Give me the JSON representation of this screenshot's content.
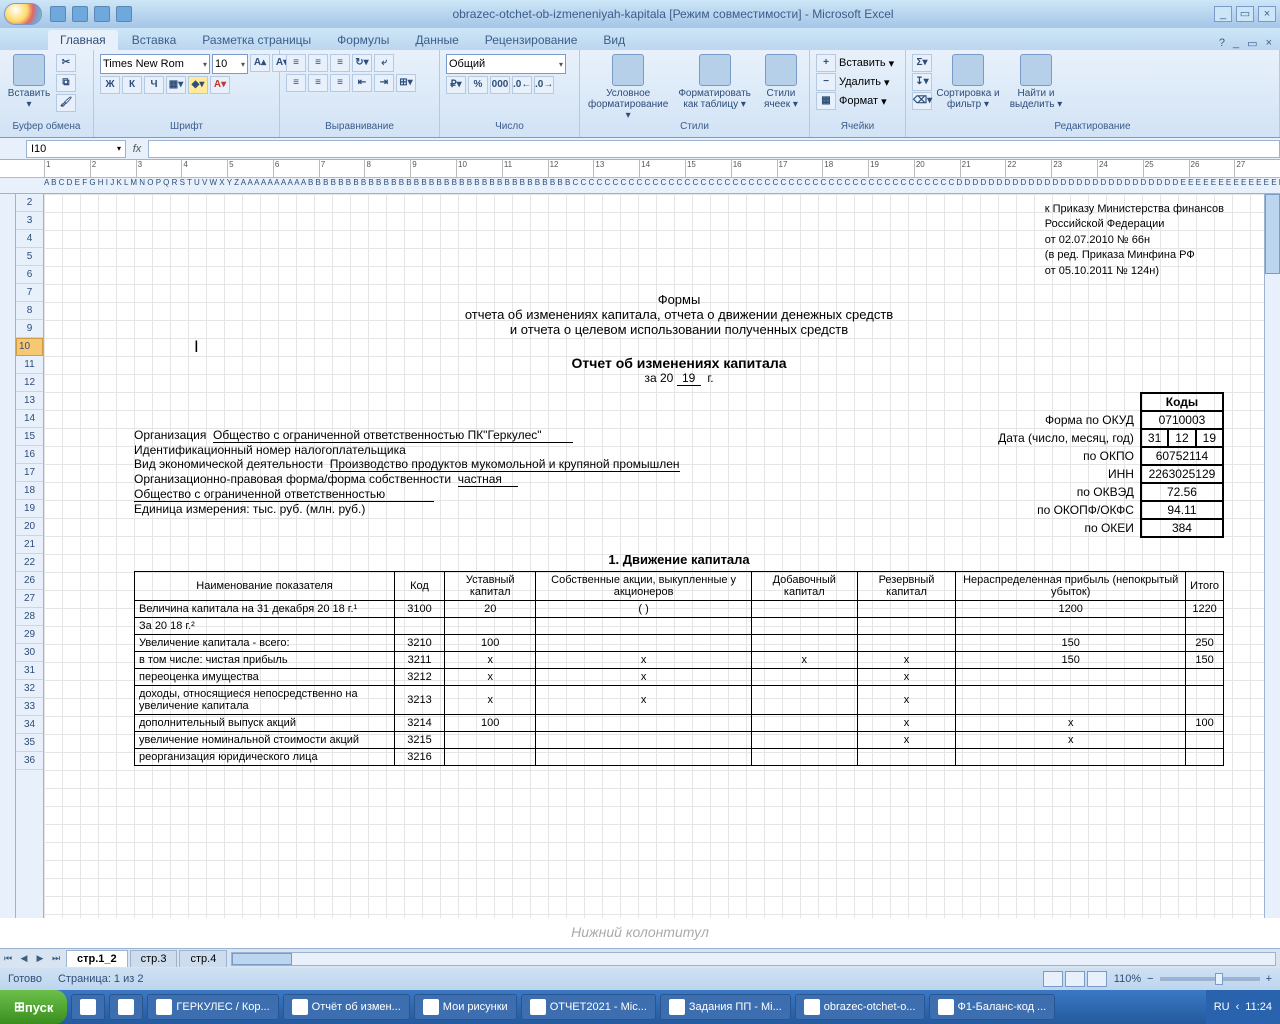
{
  "title": "obrazec-otchet-ob-izmeneniyah-kapitala  [Режим совместимости] - Microsoft Excel",
  "tabs": [
    "Главная",
    "Вставка",
    "Разметка страницы",
    "Формулы",
    "Данные",
    "Рецензирование",
    "Вид"
  ],
  "activeTab": 0,
  "ribbon": {
    "clipboard": {
      "label": "Буфер обмена",
      "paste": "Вставить"
    },
    "font": {
      "label": "Шрифт",
      "name": "Times New Rom",
      "size": "10",
      "bold": "Ж",
      "italic": "К",
      "underline": "Ч"
    },
    "align": {
      "label": "Выравнивание"
    },
    "number": {
      "label": "Число",
      "format": "Общий"
    },
    "styles": {
      "label": "Стили",
      "cond": "Условное форматирование",
      "table": "Форматировать как таблицу",
      "cell": "Стили ячеек"
    },
    "cells": {
      "label": "Ячейки",
      "insert": "Вставить",
      "delete": "Удалить",
      "format": "Формат"
    },
    "edit": {
      "label": "Редактирование",
      "sort": "Сортировка и фильтр",
      "find": "Найти и выделить"
    }
  },
  "nameBox": "I10",
  "colStrip": "A B C D E F G H I J K L M N O P Q R S T U V W X Y Z A A A A A A A A A A B B B B B B B B B B B B B B B B B B B B B B B B B B B B B B B B B B B C C C C C C C C C C C C C C C C C C C C C C C C C C C C C C C C C C C C C C C C C C C C C C C C D D D D D D D D D D D D D D D D D D D D D D D D D D D D E E E E E E E E E E E E E E E E E E E E E E E E E E E E E E",
  "rows": [
    "2",
    "3",
    "4",
    "5",
    "6",
    "7",
    "8",
    "9",
    "10",
    "11",
    "12",
    "13",
    "14",
    "15",
    "16",
    "17",
    "18",
    "19",
    "20",
    "21",
    "22",
    "26",
    "27",
    "28",
    "29",
    "30",
    "31",
    "32",
    "33",
    "34",
    "35",
    "36"
  ],
  "selRow": "10",
  "doc": {
    "hdr": [
      "к Приказу Министерства финансов",
      "Российской Федерации",
      "от 02.07.2010 № 66н",
      "(в ред. Приказа Минфина РФ",
      "от 05.10.2011 № 124н)"
    ],
    "t1": "Формы",
    "t2": "отчета об изменениях капитала, отчета о движении денежных средств",
    "t3": "и отчета о целевом использовании полученных средств",
    "title": "Отчет об изменениях капитала",
    "yearLbl": "за 20",
    "year": "19",
    "yearSuffix": "г.",
    "codesHdr": "Коды",
    "meta": [
      {
        "l": "Форма по ОКУД",
        "v": "0710003"
      },
      {
        "l": "Дата (число, месяц, год)",
        "v": [
          "31",
          "12",
          "19"
        ]
      },
      {
        "l": "по ОКПО",
        "v": "60752114",
        "p": "Организация",
        "pv": "Общество с ограниченной ответственностью ПК\"Геркулес\""
      },
      {
        "l": "ИНН",
        "v": "2263025129",
        "p": "Идентификационный номер налогоплательщика"
      },
      {
        "l": "по ОКВЭД",
        "v": "72.56",
        "p": "Вид экономической деятельности",
        "pv": "Производство продуктов мукомольной и крупяной промышлен"
      },
      {
        "l": "по ОКОПФ/ОКФС",
        "v": "94.11",
        "p": "Организационно-правовая форма/форма собственности",
        "pv": "частная",
        "p2": "Общество с ограниченной ответственностью"
      },
      {
        "l": "по ОКЕИ",
        "v": "384",
        "p": "Единица измерения: тыс. руб. (млн. руб.)"
      }
    ],
    "sec": "1. Движение капитала",
    "th": [
      "Наименование показателя",
      "Код",
      "Уставный капитал",
      "Собственные акции, выкупленные у акционеров",
      "Добавочный капитал",
      "Резервный капитал",
      "Нераспределенная прибыль (непокрытый убыток)",
      "Итого"
    ],
    "rows": [
      {
        "n": "Величина капитала на 31 декабря 20 18  г.¹",
        "c": "3100",
        "v": [
          "20",
          "(                      )",
          "",
          "",
          "1200",
          "1220"
        ]
      },
      {
        "n": "За 20 18  г.²",
        "c": "",
        "v": [
          "",
          "",
          "",
          "",
          "",
          ""
        ]
      },
      {
        "n": "Увеличение капитала - всего:",
        "c": "3210",
        "v": [
          "100",
          "",
          "",
          "",
          "150",
          "250"
        ]
      },
      {
        "n": "в том числе: чистая прибыль",
        "c": "3211",
        "v": [
          "х",
          "х",
          "х",
          "х",
          "150",
          "150"
        ]
      },
      {
        "n": "переоценка имущества",
        "c": "3212",
        "v": [
          "х",
          "х",
          "",
          "х",
          "",
          ""
        ]
      },
      {
        "n": "доходы, относящиеся непосредственно на увеличение капитала",
        "c": "3213",
        "v": [
          "х",
          "х",
          "",
          "х",
          "",
          ""
        ]
      },
      {
        "n": "дополнительный выпуск акций",
        "c": "3214",
        "v": [
          "100",
          "",
          "",
          "х",
          "х",
          "100"
        ]
      },
      {
        "n": "увеличение номинальной стоимости акций",
        "c": "3215",
        "v": [
          "",
          "",
          "",
          "х",
          "х",
          ""
        ]
      },
      {
        "n": "реорганизация юридического лица",
        "c": "3216",
        "v": [
          "",
          "",
          "",
          "",
          "",
          ""
        ]
      }
    ],
    "footer": "Нижний колонтитул"
  },
  "sheetTabs": [
    "стр.1_2",
    "стр.3",
    "стр.4"
  ],
  "activeSheet": 0,
  "status": {
    "ready": "Готово",
    "page": "Страница: 1 из 2",
    "zoom": "110%"
  },
  "taskbar": {
    "start": "пуск",
    "items": [
      "",
      "",
      "ГЕРКУЛЕС / Кор...",
      "Отчёт об измен...",
      "Мои рисунки",
      "ОТЧЕТ2021 - Mic...",
      "Задания ПП - Mi...",
      "obrazec-otchet-o...",
      "Ф1-Баланс-код ..."
    ],
    "lang": "RU",
    "time": "11:24"
  },
  "rulerMarks": [
    "1",
    "2",
    "3",
    "4",
    "5",
    "6",
    "7",
    "8",
    "9",
    "10",
    "11",
    "12",
    "13",
    "14",
    "15",
    "16",
    "17",
    "18",
    "19",
    "20",
    "21",
    "22",
    "23",
    "24",
    "25",
    "26",
    "27"
  ]
}
